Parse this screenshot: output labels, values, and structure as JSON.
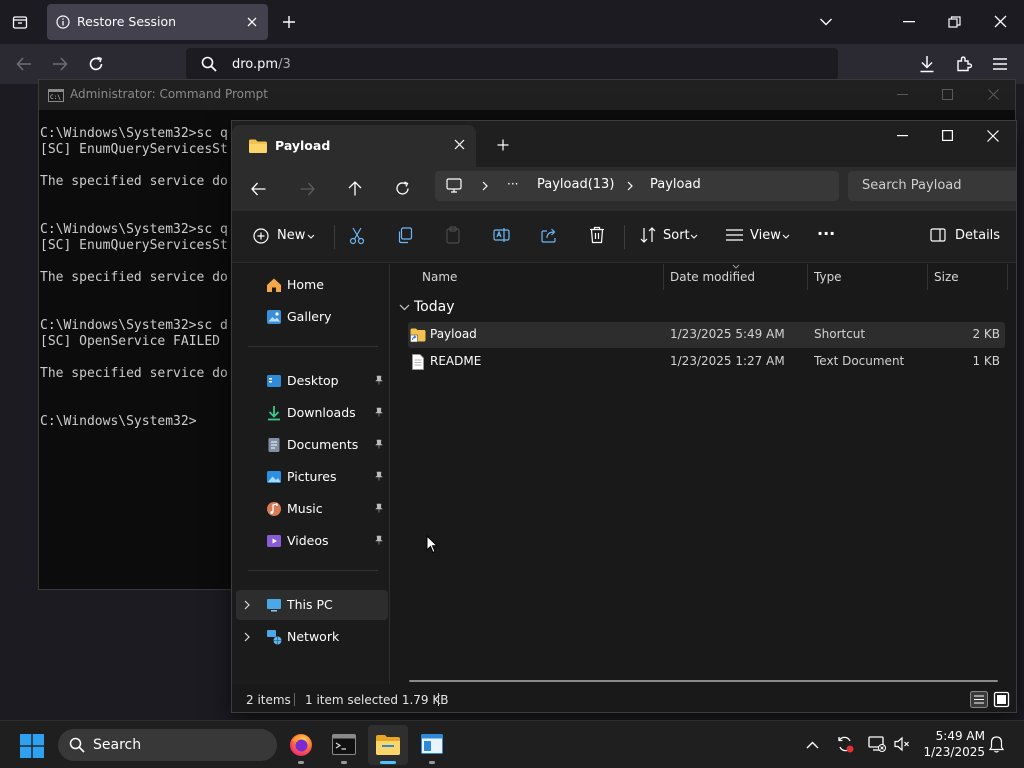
{
  "browser": {
    "tab_title": "Restore Session",
    "url_host": "dro.pm",
    "url_path": "/3"
  },
  "cmd": {
    "title": "Administrator: Command Prompt",
    "lines": [
      "C:\\Windows\\System32>sc q",
      "[SC] EnumQueryServicesSt",
      "",
      "The specified service do",
      "",
      "",
      "C:\\Windows\\System32>sc q",
      "[SC] EnumQueryServicesSt",
      "",
      "The specified service do",
      "",
      "",
      "C:\\Windows\\System32>sc d",
      "[SC] OpenService FAILED ",
      "",
      "The specified service do",
      "",
      "",
      "C:\\Windows\\System32>"
    ]
  },
  "explorer": {
    "tab_title": "Payload",
    "breadcrumb": {
      "more": "···",
      "parent": "Payload(13)",
      "current": "Payload"
    },
    "search_placeholder": "Search Payload",
    "toolbar": {
      "new": "New",
      "sort": "Sort",
      "view": "View",
      "more": "···",
      "details": "Details"
    },
    "nav": {
      "home": "Home",
      "gallery": "Gallery",
      "desktop": "Desktop",
      "downloads": "Downloads",
      "documents": "Documents",
      "pictures": "Pictures",
      "music": "Music",
      "videos": "Videos",
      "this_pc": "This PC",
      "network": "Network"
    },
    "columns": {
      "name": "Name",
      "date": "Date modified",
      "type": "Type",
      "size": "Size"
    },
    "group": "Today",
    "files": [
      {
        "name": "Payload",
        "date": "1/23/2025 5:49 AM",
        "type": "Shortcut",
        "size": "2 KB"
      },
      {
        "name": "README",
        "date": "1/23/2025 1:27 AM",
        "type": "Text Document",
        "size": "1 KB"
      }
    ],
    "status": {
      "count": "2 items",
      "selected": "1 item selected  1.79 KB"
    }
  },
  "taskbar": {
    "search": "Search",
    "time": "5:49 AM",
    "date": "1/23/2025"
  },
  "colors": {
    "accent": "#4cc2ff",
    "selection": "#2d2d2d"
  }
}
